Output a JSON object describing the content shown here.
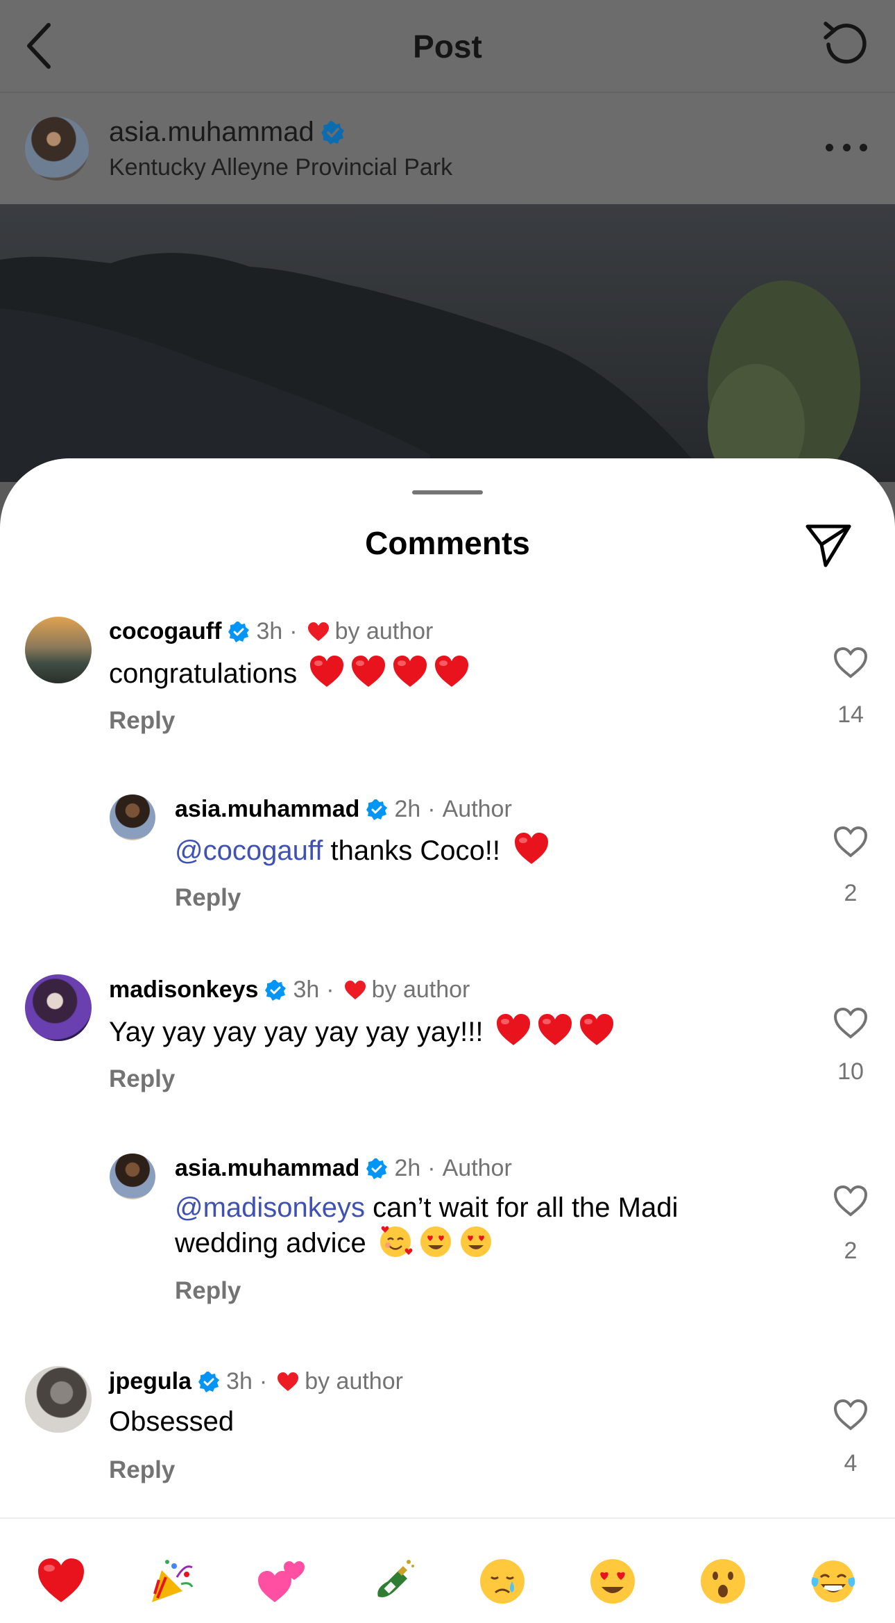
{
  "header": {
    "title": "Post",
    "back_icon": "chevron-left-icon",
    "refresh_icon": "refresh-icon"
  },
  "post": {
    "username": "asia.muhammad",
    "location": "Kentucky Alleyne Provincial Park",
    "more_icon": "more-horizontal-icon"
  },
  "comments_sheet": {
    "title": "Comments",
    "share_icon": "send-icon"
  },
  "comments": [
    {
      "username": "cocogauff",
      "time": "3h",
      "separator": "·",
      "badge": "by author",
      "text": "congratulations",
      "hearts": 4,
      "reply_label": "Reply",
      "likes": "14"
    },
    {
      "username": "asia.muhammad",
      "time": "2h",
      "separator": "·",
      "badge": "Author",
      "mention": "@cocogauff",
      "text": " thanks Coco!!",
      "hearts": 1,
      "reply_label": "Reply",
      "likes": "2"
    },
    {
      "username": "madisonkeys",
      "time": "3h",
      "separator": "·",
      "badge": "by author",
      "text": "Yay yay yay yay yay yay yay!!!",
      "hearts": 3,
      "reply_label": "Reply",
      "likes": "10"
    },
    {
      "username": "asia.muhammad",
      "time": "2h",
      "separator": "·",
      "badge": "Author",
      "mention": "@madisonkeys",
      "text_line1": " can’t wait for all the Madi",
      "text_line2": "wedding advice",
      "reply_label": "Reply",
      "likes": "2"
    },
    {
      "username": "jpegula",
      "time": "3h",
      "separator": "·",
      "badge": "by author",
      "text": "Obsessed",
      "reply_label": "Reply",
      "likes": "4"
    }
  ],
  "reactions": [
    "red-heart",
    "party-popper",
    "two-hearts",
    "champagne",
    "crying-face",
    "heart-eyes-face",
    "surprised-face",
    "tears-of-joy-face"
  ],
  "colors": {
    "verified": "#0095f6",
    "heart": "#ed1c24",
    "mention": "#3f51b5",
    "meta": "#737373"
  }
}
